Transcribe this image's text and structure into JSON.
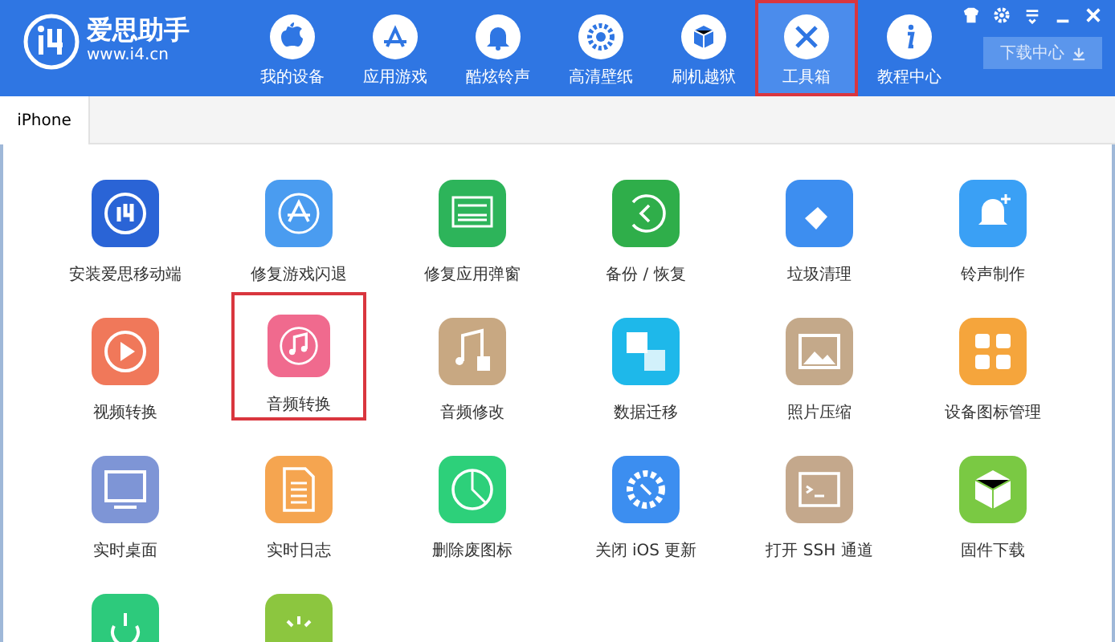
{
  "app": {
    "logo_text": "爱思助手",
    "url": "www.i4.cn"
  },
  "nav": [
    {
      "label": "我的设备",
      "selected": false,
      "highlighted": false
    },
    {
      "label": "应用游戏",
      "selected": false,
      "highlighted": false
    },
    {
      "label": "酷炫铃声",
      "selected": false,
      "highlighted": false
    },
    {
      "label": "高清壁纸",
      "selected": false,
      "highlighted": false
    },
    {
      "label": "刷机越狱",
      "selected": false,
      "highlighted": false
    },
    {
      "label": "工具箱",
      "selected": true,
      "highlighted": true
    },
    {
      "label": "教程中心",
      "selected": false,
      "highlighted": false
    }
  ],
  "download_button": {
    "label": "下载中心"
  },
  "tabs": [
    {
      "label": "iPhone",
      "selected": true
    }
  ],
  "tools": [
    {
      "label": "安装爱思移动端",
      "color": "#2a64d6",
      "highlighted": false
    },
    {
      "label": "修复游戏闪退",
      "color": "#4a9cf0",
      "highlighted": false
    },
    {
      "label": "修复应用弹窗",
      "color": "#2db45a",
      "highlighted": false
    },
    {
      "label": "备份 / 恢复",
      "color": "#2fae4a",
      "highlighted": false
    },
    {
      "label": "垃圾清理",
      "color": "#3d8ef0",
      "highlighted": false
    },
    {
      "label": "铃声制作",
      "color": "#3aa0f5",
      "highlighted": false
    },
    {
      "label": "视频转换",
      "color": "#f0785a",
      "highlighted": false
    },
    {
      "label": "音频转换",
      "color": "#f06a8e",
      "highlighted": true
    },
    {
      "label": "音频修改",
      "color": "#c8a882",
      "highlighted": false
    },
    {
      "label": "数据迁移",
      "color": "#1eb8ea",
      "highlighted": false
    },
    {
      "label": "照片压缩",
      "color": "#c4a98a",
      "highlighted": false
    },
    {
      "label": "设备图标管理",
      "color": "#f5a53c",
      "highlighted": false
    },
    {
      "label": "实时桌面",
      "color": "#7e95d6",
      "highlighted": false
    },
    {
      "label": "实时日志",
      "color": "#f5a550",
      "highlighted": false
    },
    {
      "label": "删除废图标",
      "color": "#2dd07a",
      "highlighted": false
    },
    {
      "label": "关闭 iOS 更新",
      "color": "#3c8ef0",
      "highlighted": false
    },
    {
      "label": "打开 SSH 通道",
      "color": "#c4a88c",
      "highlighted": false
    },
    {
      "label": "固件下载",
      "color": "#7ac943",
      "highlighted": false
    },
    {
      "color": "#2dca7c",
      "highlighted": false
    },
    {
      "color": "#8cc63f",
      "highlighted": false
    }
  ]
}
